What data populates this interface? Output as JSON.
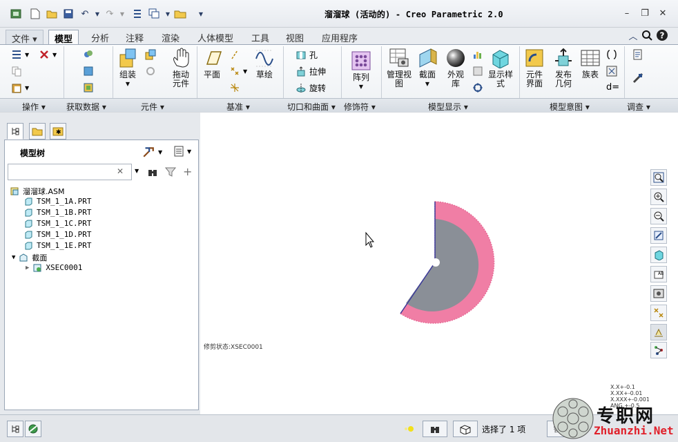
{
  "window": {
    "title": "溜溜球 (活动的) - Creo Parametric 2.0"
  },
  "tabs": [
    {
      "label": "文件"
    },
    {
      "label": "模型"
    },
    {
      "label": "分析"
    },
    {
      "label": "注释"
    },
    {
      "label": "渲染"
    },
    {
      "label": "人体模型"
    },
    {
      "label": "工具"
    },
    {
      "label": "视图"
    },
    {
      "label": "应用程序"
    }
  ],
  "ribbon": {
    "get_data": {
      "label": "获取数据"
    },
    "components": {
      "assemble": "组装",
      "drag": "拖动\n元件"
    },
    "datum": {
      "plane": "平面",
      "sketch": "草绘"
    },
    "cut_surface": {
      "hole": "孔",
      "extrude": "拉伸",
      "revolve": "旋转"
    },
    "modifiers": {
      "pattern": "阵列"
    },
    "model_display": {
      "manage_views": "管理视\n图",
      "section": "截面",
      "appearance": "外观\n库",
      "display_style": "显示样\n式"
    },
    "model_intent": {
      "component_interface": "元件\n界面",
      "publish_geometry": "发布\n几何",
      "family_table": "族表"
    },
    "groups": [
      "操作",
      "获取数据",
      "元件",
      "基准",
      "切口和曲面",
      "修饰符",
      "模型显示",
      "模型意图",
      "调查"
    ]
  },
  "model_tree": {
    "title": "模型树",
    "search_value": "",
    "root": "溜溜球.ASM",
    "parts": [
      "TSM_1_1A.PRT",
      "TSM_1_1B.PRT",
      "TSM_1_1C.PRT",
      "TSM_1_1D.PRT",
      "TSM_1_1E.PRT"
    ],
    "sections_folder": "截面",
    "section_item": "XSEC0001"
  },
  "graphics": {
    "section_status": "修剪状态:XSEC0001",
    "colors": {
      "outer_ring": "#f07ea5",
      "core": "#8a8f97",
      "edge": "#3a3a9a"
    },
    "precision_readout": [
      "X.X+-0.1",
      "X.XX+-0.01",
      "X.XXX+-0.001",
      "ANG +-0.5"
    ]
  },
  "status": {
    "selected_text": "选择了 1 项"
  },
  "watermark": {
    "brand": "专职网",
    "url": "Zhuanzhi.Net"
  }
}
